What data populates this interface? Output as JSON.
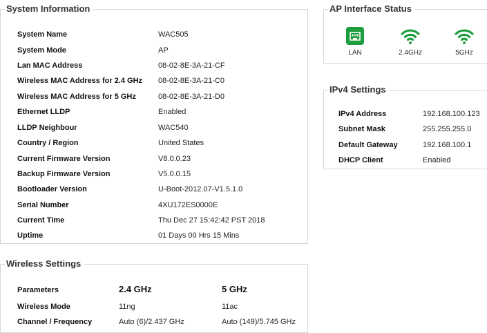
{
  "system_information": {
    "title": "System Information",
    "rows": [
      {
        "label": "System Name",
        "value": "WAC505"
      },
      {
        "label": "System Mode",
        "value": "AP"
      },
      {
        "label": "Lan MAC Address",
        "value": "08-02-8E-3A-21-CF"
      },
      {
        "label": "Wireless MAC Address for 2.4 GHz",
        "value": "08-02-8E-3A-21-C0"
      },
      {
        "label": "Wireless MAC Address for 5 GHz",
        "value": "08-02-8E-3A-21-D0"
      },
      {
        "label": "Ethernet LLDP",
        "value": "Enabled"
      },
      {
        "label": "LLDP Neighbour",
        "value": "WAC540"
      },
      {
        "label": "Country / Region",
        "value": "United States"
      },
      {
        "label": "Current Firmware Version",
        "value": "V8.0.0.23"
      },
      {
        "label": "Backup Firmware Version",
        "value": "V5.0.0.15"
      },
      {
        "label": "Bootloader Version",
        "value": "U-Boot-2012.07-V1.5.1.0"
      },
      {
        "label": "Serial Number",
        "value": "4XU172ES0000E"
      },
      {
        "label": "Current Time",
        "value": "Thu Dec 27 15:42:42 PST 2018"
      },
      {
        "label": "Uptime",
        "value": "01 Days 00 Hrs 15 Mins"
      }
    ]
  },
  "ap_interface_status": {
    "title": "AP Interface Status",
    "interfaces": [
      {
        "label": "LAN",
        "icon": "lan-port-icon"
      },
      {
        "label": "2.4GHz",
        "icon": "wifi-icon"
      },
      {
        "label": "5GHz",
        "icon": "wifi-icon"
      }
    ],
    "status_color": "#1e9e3e"
  },
  "ipv4_settings": {
    "title": "IPv4 Settings",
    "rows": [
      {
        "label": "IPv4 Address",
        "value": "192.168.100.123"
      },
      {
        "label": "Subnet Mask",
        "value": "255.255.255.0"
      },
      {
        "label": "Default Gateway",
        "value": "192.168.100.1"
      },
      {
        "label": "DHCP Client",
        "value": "Enabled"
      }
    ]
  },
  "wireless_settings": {
    "title": "Wireless Settings",
    "header": {
      "label": "Parameters",
      "band1": "2.4 GHz",
      "band2": "5 GHz"
    },
    "rows": [
      {
        "label": "Wireless Mode",
        "band1": "11ng",
        "band2": "11ac"
      },
      {
        "label": "Channel / Frequency",
        "band1": "Auto (6)/2.437 GHz",
        "band2": "Auto (149)/5.745 GHz"
      }
    ]
  }
}
